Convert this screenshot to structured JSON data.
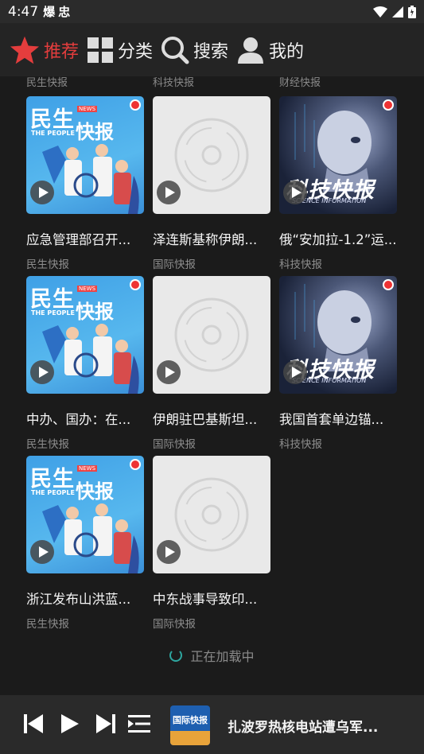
{
  "status_bar": {
    "time": "4:47",
    "notif_1": "爆",
    "notif_2": "忠"
  },
  "nav": {
    "items": [
      {
        "label": "推荐",
        "icon": "star-icon",
        "active": true,
        "color": "#e43d3d"
      },
      {
        "label": "分类",
        "icon": "grid-icon",
        "active": false
      },
      {
        "label": "搜索",
        "icon": "search-icon",
        "active": false
      },
      {
        "label": "我的",
        "icon": "person-icon",
        "active": false
      }
    ]
  },
  "partial_row": {
    "sources": [
      "民生快报",
      "科技快报",
      "财经快报"
    ]
  },
  "grid": {
    "cards": [
      {
        "title": "应急管理部召开...",
        "source": "民生快报",
        "cover": "minsheng"
      },
      {
        "title": "泽连斯基称伊朗...",
        "source": "国际快报",
        "cover": "placeholder"
      },
      {
        "title": "俄“安加拉-1.2”运...",
        "source": "科技快报",
        "cover": "keji"
      },
      {
        "title": "中办、国办：在...",
        "source": "民生快报",
        "cover": "minsheng"
      },
      {
        "title": "伊朗驻巴基斯坦...",
        "source": "国际快报",
        "cover": "placeholder"
      },
      {
        "title": "我国首套单边锚...",
        "source": "科技快报",
        "cover": "keji"
      },
      {
        "title": "浙江发布山洪蓝...",
        "source": "民生快报",
        "cover": "minsheng"
      },
      {
        "title": "中东战事导致印...",
        "source": "国际快报",
        "cover": "placeholder"
      }
    ],
    "cover_text": {
      "minsheng_title_1": "民生",
      "minsheng_title_2": "快报",
      "minsheng_news": "NEWS",
      "minsheng_sub": "THE PEOPLE",
      "keji_title": "科技快报",
      "keji_sub": "SCIENCE INFORMATION"
    }
  },
  "loading": {
    "text": "正在加载中"
  },
  "player": {
    "now_playing_title": "扎波罗热核电站遭乌军...",
    "cover_text": "国际快报"
  }
}
